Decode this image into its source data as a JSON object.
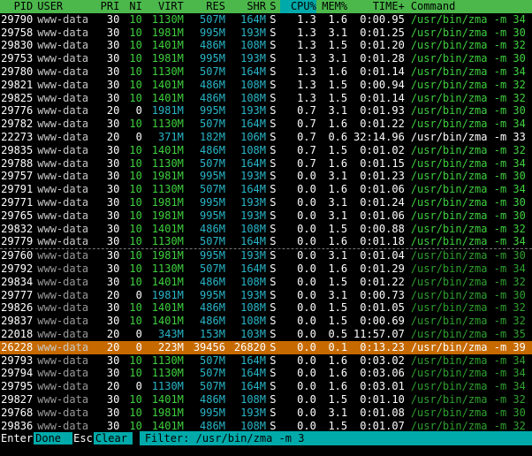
{
  "header": {
    "pid": "PID",
    "user": "USER",
    "pri": "PRI",
    "ni": "NI",
    "virt": "VIRT",
    "res": "RES",
    "shr": "SHR",
    "s": "S",
    "cpu": "CPU%",
    "mem": "MEM%",
    "time": "TIME+",
    "command": "Command"
  },
  "rows": [
    {
      "pid": "29790",
      "user": "www-data",
      "pri": "30",
      "ni": "10",
      "virt": "1130M",
      "res": "507M",
      "shr": "164M",
      "s": "S",
      "cpu": "1.3",
      "mem": "1.6",
      "time": "0:00.95",
      "cmd": "/usr/bin/zma -m 34",
      "dim": false
    },
    {
      "pid": "29758",
      "user": "www-data",
      "pri": "30",
      "ni": "10",
      "virt": "1981M",
      "res": "995M",
      "shr": "193M",
      "s": "S",
      "cpu": "1.3",
      "mem": "3.1",
      "time": "0:01.25",
      "cmd": "/usr/bin/zma -m 30",
      "dim": false
    },
    {
      "pid": "29830",
      "user": "www-data",
      "pri": "30",
      "ni": "10",
      "virt": "1401M",
      "res": "486M",
      "shr": "108M",
      "s": "S",
      "cpu": "1.3",
      "mem": "1.5",
      "time": "0:01.20",
      "cmd": "/usr/bin/zma -m 32",
      "dim": false
    },
    {
      "pid": "29753",
      "user": "www-data",
      "pri": "30",
      "ni": "10",
      "virt": "1981M",
      "res": "995M",
      "shr": "193M",
      "s": "S",
      "cpu": "1.3",
      "mem": "3.1",
      "time": "0:01.28",
      "cmd": "/usr/bin/zma -m 30",
      "dim": false
    },
    {
      "pid": "29780",
      "user": "www-data",
      "pri": "30",
      "ni": "10",
      "virt": "1130M",
      "res": "507M",
      "shr": "164M",
      "s": "S",
      "cpu": "1.3",
      "mem": "1.6",
      "time": "0:01.14",
      "cmd": "/usr/bin/zma -m 34",
      "dim": false
    },
    {
      "pid": "29821",
      "user": "www-data",
      "pri": "30",
      "ni": "10",
      "virt": "1401M",
      "res": "486M",
      "shr": "108M",
      "s": "S",
      "cpu": "1.3",
      "mem": "1.5",
      "time": "0:00.94",
      "cmd": "/usr/bin/zma -m 32",
      "dim": false
    },
    {
      "pid": "29825",
      "user": "www-data",
      "pri": "30",
      "ni": "10",
      "virt": "1401M",
      "res": "486M",
      "shr": "108M",
      "s": "S",
      "cpu": "1.3",
      "mem": "1.5",
      "time": "0:01.14",
      "cmd": "/usr/bin/zma -m 32",
      "dim": false
    },
    {
      "pid": "29776",
      "user": "www-data",
      "pri": "20",
      "ni": "0",
      "virt": "1981M",
      "res": "995M",
      "shr": "193M",
      "s": "S",
      "cpu": "0.7",
      "mem": "3.1",
      "time": "0:01.93",
      "cmd": "/usr/bin/zma -m 30",
      "dim": false
    },
    {
      "pid": "29782",
      "user": "www-data",
      "pri": "30",
      "ni": "10",
      "virt": "1130M",
      "res": "507M",
      "shr": "164M",
      "s": "S",
      "cpu": "0.7",
      "mem": "1.6",
      "time": "0:01.22",
      "cmd": "/usr/bin/zma -m 34",
      "dim": false
    },
    {
      "pid": "22273",
      "user": "www-data",
      "pri": "20",
      "ni": "0",
      "virt": "371M",
      "res": "182M",
      "shr": "106M",
      "s": "S",
      "cpu": "0.7",
      "mem": "0.6",
      "time": "32:14.96",
      "cmd": "/usr/bin/zma -m 33",
      "dim": false,
      "white": true
    },
    {
      "pid": "29835",
      "user": "www-data",
      "pri": "30",
      "ni": "10",
      "virt": "1401M",
      "res": "486M",
      "shr": "108M",
      "s": "S",
      "cpu": "0.7",
      "mem": "1.5",
      "time": "0:01.02",
      "cmd": "/usr/bin/zma -m 32",
      "dim": false
    },
    {
      "pid": "29788",
      "user": "www-data",
      "pri": "30",
      "ni": "10",
      "virt": "1130M",
      "res": "507M",
      "shr": "164M",
      "s": "S",
      "cpu": "0.7",
      "mem": "1.6",
      "time": "0:01.15",
      "cmd": "/usr/bin/zma -m 34",
      "dim": false
    },
    {
      "pid": "29757",
      "user": "www-data",
      "pri": "30",
      "ni": "10",
      "virt": "1981M",
      "res": "995M",
      "shr": "193M",
      "s": "S",
      "cpu": "0.0",
      "mem": "3.1",
      "time": "0:01.23",
      "cmd": "/usr/bin/zma -m 30",
      "dim": false
    },
    {
      "pid": "29791",
      "user": "www-data",
      "pri": "30",
      "ni": "10",
      "virt": "1130M",
      "res": "507M",
      "shr": "164M",
      "s": "S",
      "cpu": "0.0",
      "mem": "1.6",
      "time": "0:01.06",
      "cmd": "/usr/bin/zma -m 34",
      "dim": false
    },
    {
      "pid": "29771",
      "user": "www-data",
      "pri": "30",
      "ni": "10",
      "virt": "1981M",
      "res": "995M",
      "shr": "193M",
      "s": "S",
      "cpu": "0.0",
      "mem": "3.1",
      "time": "0:01.24",
      "cmd": "/usr/bin/zma -m 30",
      "dim": false
    },
    {
      "pid": "29765",
      "user": "www-data",
      "pri": "30",
      "ni": "10",
      "virt": "1981M",
      "res": "995M",
      "shr": "193M",
      "s": "S",
      "cpu": "0.0",
      "mem": "3.1",
      "time": "0:01.06",
      "cmd": "/usr/bin/zma -m 30",
      "dim": false
    },
    {
      "pid": "29832",
      "user": "www-data",
      "pri": "30",
      "ni": "10",
      "virt": "1401M",
      "res": "486M",
      "shr": "108M",
      "s": "S",
      "cpu": "0.0",
      "mem": "1.5",
      "time": "0:00.88",
      "cmd": "/usr/bin/zma -m 32",
      "dim": false
    },
    {
      "pid": "29779",
      "user": "www-data",
      "pri": "30",
      "ni": "10",
      "virt": "1130M",
      "res": "507M",
      "shr": "164M",
      "s": "S",
      "cpu": "0.0",
      "mem": "1.6",
      "time": "0:01.18",
      "cmd": "/usr/bin/zma -m 34",
      "dim": false
    },
    {
      "pid": "29760",
      "user": "www-data",
      "pri": "30",
      "ni": "10",
      "virt": "1981M",
      "res": "995M",
      "shr": "193M",
      "s": "S",
      "cpu": "0.0",
      "mem": "3.1",
      "time": "0:01.04",
      "cmd": "/usr/bin/zma -m 30",
      "dim": true,
      "sep": true
    },
    {
      "pid": "29792",
      "user": "www-data",
      "pri": "30",
      "ni": "10",
      "virt": "1130M",
      "res": "507M",
      "shr": "164M",
      "s": "S",
      "cpu": "0.0",
      "mem": "1.6",
      "time": "0:01.29",
      "cmd": "/usr/bin/zma -m 34",
      "dim": true
    },
    {
      "pid": "29834",
      "user": "www-data",
      "pri": "30",
      "ni": "10",
      "virt": "1401M",
      "res": "486M",
      "shr": "108M",
      "s": "S",
      "cpu": "0.0",
      "mem": "1.5",
      "time": "0:01.22",
      "cmd": "/usr/bin/zma -m 32",
      "dim": true
    },
    {
      "pid": "29777",
      "user": "www-data",
      "pri": "20",
      "ni": "0",
      "virt": "1981M",
      "res": "995M",
      "shr": "193M",
      "s": "S",
      "cpu": "0.0",
      "mem": "3.1",
      "time": "0:00.73",
      "cmd": "/usr/bin/zma -m 30",
      "dim": true
    },
    {
      "pid": "29826",
      "user": "www-data",
      "pri": "30",
      "ni": "10",
      "virt": "1401M",
      "res": "486M",
      "shr": "108M",
      "s": "S",
      "cpu": "0.0",
      "mem": "1.5",
      "time": "0:01.05",
      "cmd": "/usr/bin/zma -m 32",
      "dim": true
    },
    {
      "pid": "29837",
      "user": "www-data",
      "pri": "30",
      "ni": "10",
      "virt": "1401M",
      "res": "486M",
      "shr": "108M",
      "s": "S",
      "cpu": "0.0",
      "mem": "1.5",
      "time": "0:00.69",
      "cmd": "/usr/bin/zma -m 32",
      "dim": true
    },
    {
      "pid": "22018",
      "user": "www-data",
      "pri": "20",
      "ni": "0",
      "virt": "343M",
      "res": "153M",
      "shr": "103M",
      "s": "S",
      "cpu": "0.0",
      "mem": "0.5",
      "time": "11:57.07",
      "cmd": "/usr/bin/zma -m 35",
      "dim": true,
      "white": true
    },
    {
      "pid": "26228",
      "user": "www-data",
      "pri": "20",
      "ni": "0",
      "virt": "223M",
      "res": "39456",
      "shr": "26820",
      "s": "S",
      "cpu": "0.0",
      "mem": "0.1",
      "time": "0:13.23",
      "cmd": "/usr/bin/zma -m 39",
      "selected": true
    },
    {
      "pid": "29793",
      "user": "www-data",
      "pri": "30",
      "ni": "10",
      "virt": "1130M",
      "res": "507M",
      "shr": "164M",
      "s": "S",
      "cpu": "0.0",
      "mem": "1.6",
      "time": "0:03.02",
      "cmd": "/usr/bin/zma -m 34",
      "dim": true
    },
    {
      "pid": "29794",
      "user": "www-data",
      "pri": "30",
      "ni": "10",
      "virt": "1130M",
      "res": "507M",
      "shr": "164M",
      "s": "S",
      "cpu": "0.0",
      "mem": "1.6",
      "time": "0:03.06",
      "cmd": "/usr/bin/zma -m 34",
      "dim": true
    },
    {
      "pid": "29795",
      "user": "www-data",
      "pri": "20",
      "ni": "0",
      "virt": "1130M",
      "res": "507M",
      "shr": "164M",
      "s": "S",
      "cpu": "0.0",
      "mem": "1.6",
      "time": "0:03.01",
      "cmd": "/usr/bin/zma -m 34",
      "dim": true
    },
    {
      "pid": "29827",
      "user": "www-data",
      "pri": "30",
      "ni": "10",
      "virt": "1401M",
      "res": "486M",
      "shr": "108M",
      "s": "S",
      "cpu": "0.0",
      "mem": "1.5",
      "time": "0:01.10",
      "cmd": "/usr/bin/zma -m 32",
      "dim": true
    },
    {
      "pid": "29768",
      "user": "www-data",
      "pri": "30",
      "ni": "10",
      "virt": "1981M",
      "res": "995M",
      "shr": "193M",
      "s": "S",
      "cpu": "0.0",
      "mem": "3.1",
      "time": "0:01.08",
      "cmd": "/usr/bin/zma -m 30",
      "dim": true
    },
    {
      "pid": "29836",
      "user": "www-data",
      "pri": "30",
      "ni": "10",
      "virt": "1401M",
      "res": "486M",
      "shr": "108M",
      "s": "S",
      "cpu": "0.0",
      "mem": "1.5",
      "time": "0:01.07",
      "cmd": "/usr/bin/zma -m 32",
      "dim": true
    }
  ],
  "footer": {
    "enter_key": "Enter",
    "enter_label": "Done",
    "esc_key": "Esc",
    "esc_label": "Clear",
    "filter_text": "Filter: /usr/bin/zma -m 3"
  }
}
